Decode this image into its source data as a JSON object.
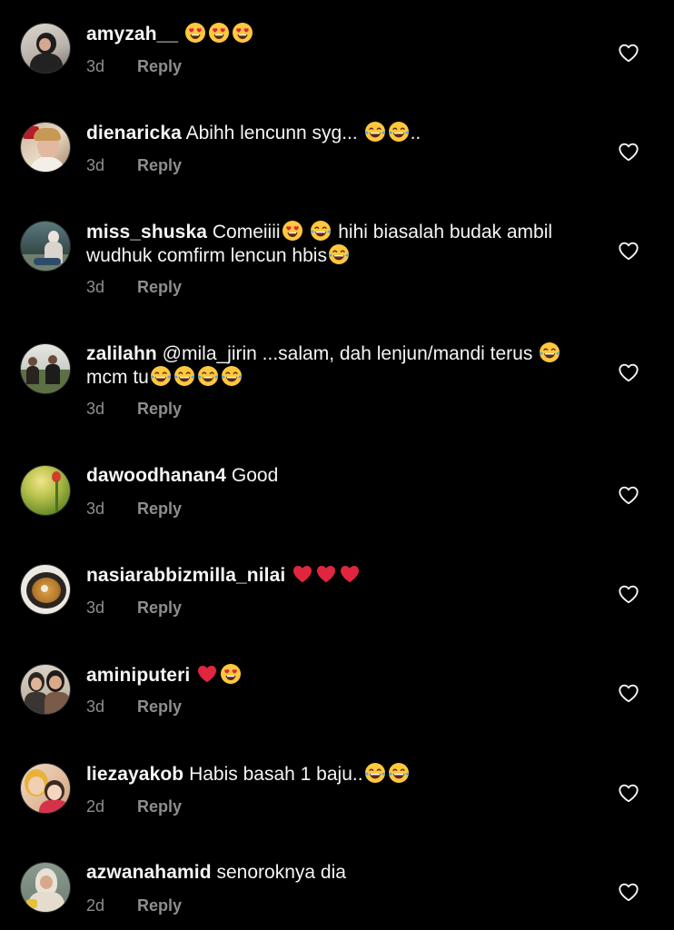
{
  "colors": {
    "background": "#000000",
    "text": "#f5f5f5",
    "secondary": "#8e8e8e",
    "heart_red": "#e0263f",
    "emoji_yellow": "#ffc83d"
  },
  "comments": [
    {
      "username": "amyzah__",
      "parts": [
        {
          "emoji": "heart-eyes"
        },
        {
          "emoji": "heart-eyes"
        },
        {
          "emoji": "heart-eyes"
        }
      ],
      "time": "3d",
      "reply": "Reply"
    },
    {
      "username": "dienaricka",
      "parts": [
        {
          "text": "Abihh lencunn syg... "
        },
        {
          "emoji": "tears-of-joy"
        },
        {
          "emoji": "tears-of-joy"
        },
        {
          "text": ".."
        }
      ],
      "time": "3d",
      "reply": "Reply"
    },
    {
      "username": "miss_shuska",
      "parts": [
        {
          "text": "Comeiiii"
        },
        {
          "emoji": "heart-eyes"
        },
        {
          "text": " "
        },
        {
          "emoji": "tears-of-joy"
        },
        {
          "text": " hihi biasalah budak ambil wudhuk comfirm lencun hbis"
        },
        {
          "emoji": "tears-of-joy"
        }
      ],
      "time": "3d",
      "reply": "Reply"
    },
    {
      "username": "zalilahn",
      "parts": [
        {
          "text": "@mila_jirin ...salam, dah lenjun/mandi terus "
        },
        {
          "emoji": "tears-of-joy"
        },
        {
          "text": "mcm tu"
        },
        {
          "emoji": "tears-of-joy"
        },
        {
          "emoji": "tears-of-joy"
        },
        {
          "emoji": "tears-of-joy"
        },
        {
          "emoji": "tears-of-joy"
        }
      ],
      "time": "3d",
      "reply": "Reply"
    },
    {
      "username": "dawoodhanan4",
      "parts": [
        {
          "text": "Good"
        }
      ],
      "time": "3d",
      "reply": "Reply"
    },
    {
      "username": "nasiarabbizmilla_nilai",
      "parts": [
        {
          "text": " "
        },
        {
          "emoji": "red-heart"
        },
        {
          "emoji": "red-heart"
        },
        {
          "emoji": "red-heart"
        }
      ],
      "time": "3d",
      "reply": "Reply"
    },
    {
      "username": "aminiputeri",
      "parts": [
        {
          "text": " "
        },
        {
          "emoji": "red-heart"
        },
        {
          "emoji": "heart-eyes"
        }
      ],
      "time": "3d",
      "reply": "Reply"
    },
    {
      "username": "liezayakob",
      "parts": [
        {
          "text": "Habis basah 1 baju.."
        },
        {
          "emoji": "tears-of-joy"
        },
        {
          "emoji": "tears-of-joy"
        }
      ],
      "time": "2d",
      "reply": "Reply"
    },
    {
      "username": "azwanahamid",
      "parts": [
        {
          "text": "senoroknya dia"
        }
      ],
      "time": "2d",
      "reply": "Reply"
    }
  ],
  "icons": {
    "like": "heart-outline-icon",
    "avatar": "avatar-photo"
  }
}
